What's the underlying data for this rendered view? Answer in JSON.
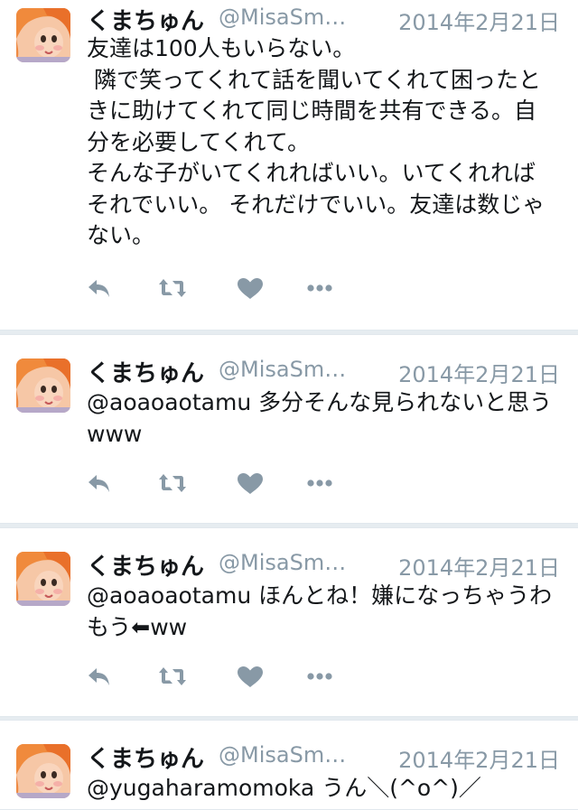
{
  "colors": {
    "background": "#e6ecf0",
    "card": "#ffffff",
    "name": "#14171a",
    "meta": "#8899a6",
    "icon": "#8899a6"
  },
  "icons": [
    "reply-icon",
    "retweet-icon",
    "like-icon",
    "more-icon"
  ],
  "tweets": [
    {
      "name": "くまちゅん",
      "handle": "@MisaSm…",
      "date": "2014年2月21日",
      "text": "友達は100人もいらない。\n 隣で笑ってくれて話を聞いてくれて困ったときに助けてくれて同じ時間を共有できる。自分を必要してくれて。\nそんな子がいてくれればいい。いてくれればそれでいい。 それだけでいい。友達は数じゃない。"
    },
    {
      "name": "くまちゅん",
      "handle": "@MisaSm…",
      "date": "2014年2月21日",
      "text": "@aoaoaotamu 多分そんな見られないと思うwww"
    },
    {
      "name": "くまちゅん",
      "handle": "@MisaSm…",
      "date": "2014年2月21日",
      "text": "@aoaoaotamu ほんとね！嫌になっちゃうわもう⬅ww"
    },
    {
      "name": "くまちゅん",
      "handle": "@MisaSm…",
      "date": "2014年2月21日",
      "text": "@yugaharamomoka うん＼(^o^)／"
    }
  ]
}
